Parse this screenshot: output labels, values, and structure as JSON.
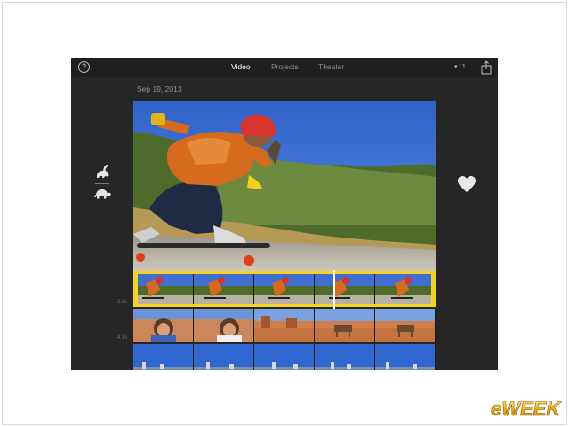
{
  "topbar": {
    "tabs": [
      {
        "label": "Video",
        "active": true
      },
      {
        "label": "Projects",
        "active": false
      },
      {
        "label": "Theater",
        "active": false
      }
    ],
    "status_text": "▾ 11",
    "help_icon": "question-circle-icon",
    "share_icon": "share-icon"
  },
  "library": {
    "date_label": "Sep 19, 2013"
  },
  "speed": {
    "fast_icon": "rabbit-icon",
    "slow_icon": "turtle-icon"
  },
  "favorite_icon": "heart-icon",
  "timeline": {
    "clips": [
      {
        "duration": "2.6s",
        "selected": true,
        "frames": 5
      },
      {
        "duration": "4.1s",
        "selected": false,
        "frames": 5
      },
      {
        "duration": "",
        "selected": false,
        "frames": 5
      }
    ],
    "selection_color": "#f6d31f"
  },
  "watermark": {
    "text": "eWEEK"
  },
  "colors": {
    "app_background": "#262626",
    "accent": "#f6d31f"
  }
}
